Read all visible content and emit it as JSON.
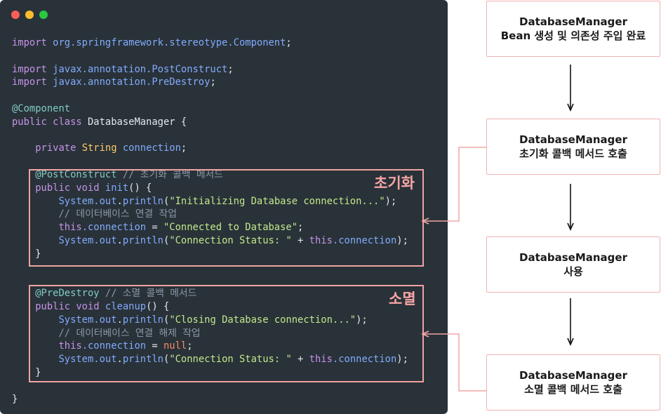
{
  "window_controls": [
    "close",
    "minimize",
    "maximize"
  ],
  "code_lines": [
    [
      {
        "t": "import",
        "c": "kw"
      },
      {
        "t": " org.springframework.stereotype.",
        "c": "pk"
      },
      {
        "t": "Component",
        "c": "pk"
      },
      {
        "t": ";",
        "c": ""
      }
    ],
    [],
    [
      {
        "t": "import",
        "c": "kw"
      },
      {
        "t": " javax.annotation.PostConstruct",
        "c": "pk"
      },
      {
        "t": ";",
        "c": ""
      }
    ],
    [
      {
        "t": "import",
        "c": "kw"
      },
      {
        "t": " javax.annotation.PreDestroy",
        "c": "pk"
      },
      {
        "t": ";",
        "c": ""
      }
    ],
    [],
    [
      {
        "t": "@Component",
        "c": "an"
      }
    ],
    [
      {
        "t": "public class",
        "c": "kw"
      },
      {
        "t": " DatabaseManager {",
        "c": ""
      }
    ],
    [],
    [
      {
        "t": "    private ",
        "c": "kw"
      },
      {
        "t": "String",
        "c": "ty"
      },
      {
        "t": " connection",
        "c": "pk"
      },
      {
        "t": ";",
        "c": ""
      }
    ],
    [],
    [
      {
        "t": "    @PostConstruct",
        "c": "an"
      },
      {
        "t": " // 초기화 콜백 메서드",
        "c": "cm"
      }
    ],
    [
      {
        "t": "    public void ",
        "c": "kw"
      },
      {
        "t": "init",
        "c": "fn"
      },
      {
        "t": "() {",
        "c": ""
      }
    ],
    [
      {
        "t": "        System.",
        "c": "pk"
      },
      {
        "t": "out",
        "c": "pk"
      },
      {
        "t": ".",
        "c": ""
      },
      {
        "t": "println",
        "c": "fn"
      },
      {
        "t": "(",
        "c": ""
      },
      {
        "t": "\"Initializing Database connection...\"",
        "c": "st"
      },
      {
        "t": ");",
        "c": ""
      }
    ],
    [
      {
        "t": "        // 데이터베이스 연결 작업",
        "c": "cm"
      }
    ],
    [
      {
        "t": "        this",
        "c": "kw"
      },
      {
        "t": ".connection",
        "c": "pk"
      },
      {
        "t": " = ",
        "c": ""
      },
      {
        "t": "\"Connected to Database\"",
        "c": "st"
      },
      {
        "t": ";",
        "c": ""
      }
    ],
    [
      {
        "t": "        System.",
        "c": "pk"
      },
      {
        "t": "out",
        "c": "pk"
      },
      {
        "t": ".",
        "c": ""
      },
      {
        "t": "println",
        "c": "fn"
      },
      {
        "t": "(",
        "c": ""
      },
      {
        "t": "\"Connection Status: \"",
        "c": "st"
      },
      {
        "t": " + ",
        "c": ""
      },
      {
        "t": "this",
        "c": "kw"
      },
      {
        "t": ".connection",
        "c": "pk"
      },
      {
        "t": ");",
        "c": ""
      }
    ],
    [
      {
        "t": "    }",
        "c": ""
      }
    ],
    [],
    [],
    [
      {
        "t": "    @PreDestroy",
        "c": "an"
      },
      {
        "t": " // 소멸 콜백 메서드",
        "c": "cm"
      }
    ],
    [
      {
        "t": "    public void ",
        "c": "kw"
      },
      {
        "t": "cleanup",
        "c": "fn"
      },
      {
        "t": "() {",
        "c": ""
      }
    ],
    [
      {
        "t": "        System.",
        "c": "pk"
      },
      {
        "t": "out",
        "c": "pk"
      },
      {
        "t": ".",
        "c": ""
      },
      {
        "t": "println",
        "c": "fn"
      },
      {
        "t": "(",
        "c": ""
      },
      {
        "t": "\"Closing Database connection...\"",
        "c": "st"
      },
      {
        "t": ");",
        "c": ""
      }
    ],
    [
      {
        "t": "        // 데이터베이스 연결 해제 작업",
        "c": "cm"
      }
    ],
    [
      {
        "t": "        this",
        "c": "kw"
      },
      {
        "t": ".connection",
        "c": "pk"
      },
      {
        "t": " = ",
        "c": ""
      },
      {
        "t": "null",
        "c": "nu"
      },
      {
        "t": ";",
        "c": ""
      }
    ],
    [
      {
        "t": "        System.",
        "c": "pk"
      },
      {
        "t": "out",
        "c": "pk"
      },
      {
        "t": ".",
        "c": ""
      },
      {
        "t": "println",
        "c": "fn"
      },
      {
        "t": "(",
        "c": ""
      },
      {
        "t": "\"Connection Status: \"",
        "c": "st"
      },
      {
        "t": " + ",
        "c": ""
      },
      {
        "t": "this",
        "c": "kw"
      },
      {
        "t": ".connection",
        "c": "pk"
      },
      {
        "t": ");",
        "c": ""
      }
    ],
    [
      {
        "t": "    }",
        "c": ""
      }
    ],
    [],
    [
      {
        "t": "}",
        "c": ""
      }
    ]
  ],
  "labels": {
    "init": "초기화",
    "destroy": "소멸"
  },
  "flow": [
    {
      "line1": "DatabaseManager",
      "line2": "Bean 생성 및 의존성 주입 완료"
    },
    {
      "line1": "DatabaseManager",
      "line2": "초기화 콜백 메서드 호출"
    },
    {
      "line1": "DatabaseManager",
      "line2": "사용"
    },
    {
      "line1": "DatabaseManager",
      "line2": "소멸 콜백 메서드 호출"
    }
  ],
  "colors": {
    "editor_bg": "#293238",
    "highlight": "#f2a3a3",
    "connector": "#f1b2b2"
  }
}
